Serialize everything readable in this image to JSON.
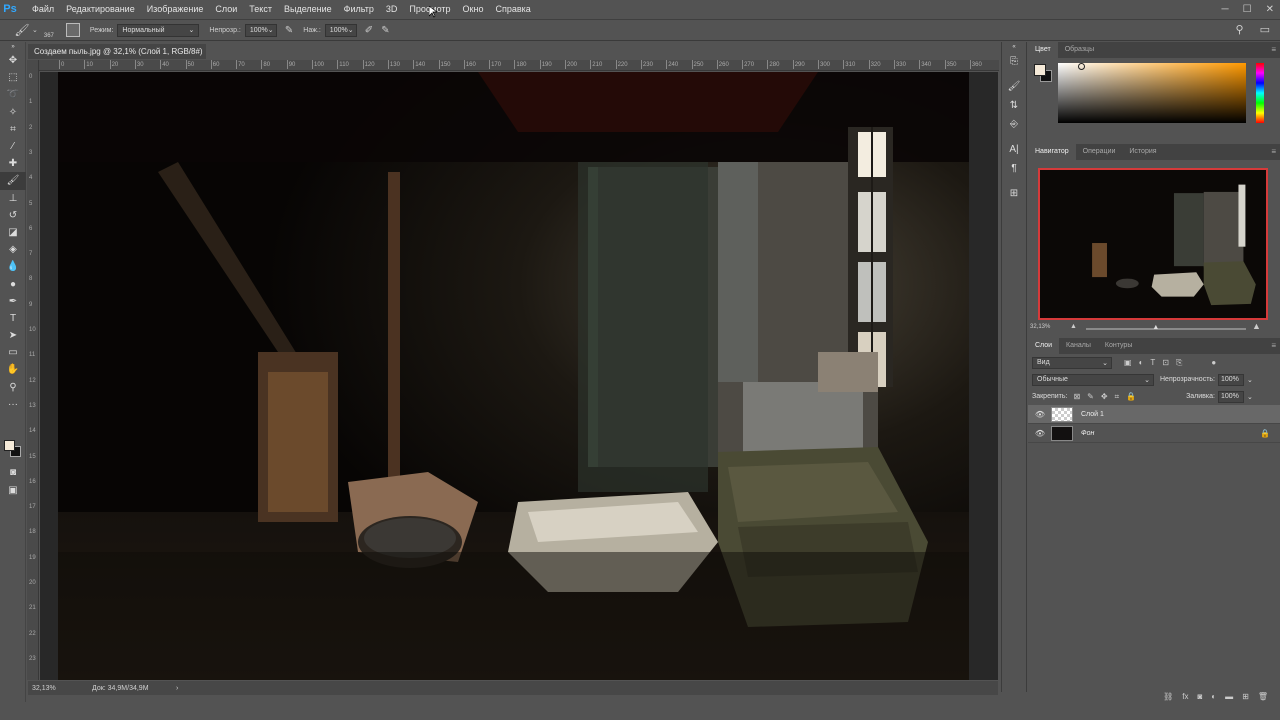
{
  "app": {
    "logo": "Ps"
  },
  "menu": [
    "Файл",
    "Редактирование",
    "Изображение",
    "Слои",
    "Текст",
    "Выделение",
    "Фильтр",
    "3D",
    "Просмотр",
    "Окно",
    "Справка"
  ],
  "window_controls": {
    "minimize": "─",
    "maximize": "☐",
    "close": "✕"
  },
  "options": {
    "brush_size": "367",
    "mode_label": "Режим:",
    "mode_value": "Нормальный",
    "opacity_label": "Непрозр.:",
    "opacity_value": "100%",
    "flow_label": "Наж.:",
    "flow_value": "100%"
  },
  "document": {
    "tab_title": "Создаем пыль.jpg @ 32,1% (Слой 1, RGB/8#) *",
    "ruler_top": [
      "0",
      "10",
      "20",
      "30",
      "40",
      "50",
      "60",
      "70",
      "80",
      "90",
      "100",
      "110",
      "120",
      "130",
      "140",
      "150",
      "160",
      "170",
      "180",
      "190",
      "200",
      "210",
      "220",
      "230",
      "240",
      "250",
      "260",
      "270",
      "280",
      "290",
      "300",
      "310",
      "320",
      "330",
      "340",
      "350",
      "360"
    ],
    "ruler_left": [
      "0",
      "1",
      "2",
      "3",
      "4",
      "5",
      "6",
      "7",
      "8",
      "9",
      "10",
      "11",
      "12",
      "13",
      "14",
      "15",
      "16",
      "17",
      "18",
      "19",
      "20",
      "21",
      "22",
      "23",
      "24"
    ]
  },
  "status": {
    "zoom": "32,13%",
    "doc": "Док: 34,9M/34,9M",
    "arrow": "›"
  },
  "color_panel": {
    "tabs": [
      "Цвет",
      "Образцы"
    ],
    "fg_color": "#f5ead8",
    "bg_color": "#111111"
  },
  "navigator": {
    "tabs": [
      "Навигатор",
      "Операции",
      "История"
    ],
    "zoom": "32,13%",
    "slider_level": 0.44
  },
  "layers_panel": {
    "tabs": [
      "Слои",
      "Каналы",
      "Контуры"
    ],
    "filter_value": "Вид",
    "blend_value": "Обычные",
    "opacity_label": "Непрозрачность:",
    "opacity_value": "100%",
    "lock_label": "Закрепить:",
    "fill_label": "Заливка:",
    "fill_value": "100%",
    "layers": [
      {
        "name": "Слой 1",
        "selected": true
      },
      {
        "name": "Фон",
        "selected": false
      }
    ]
  }
}
